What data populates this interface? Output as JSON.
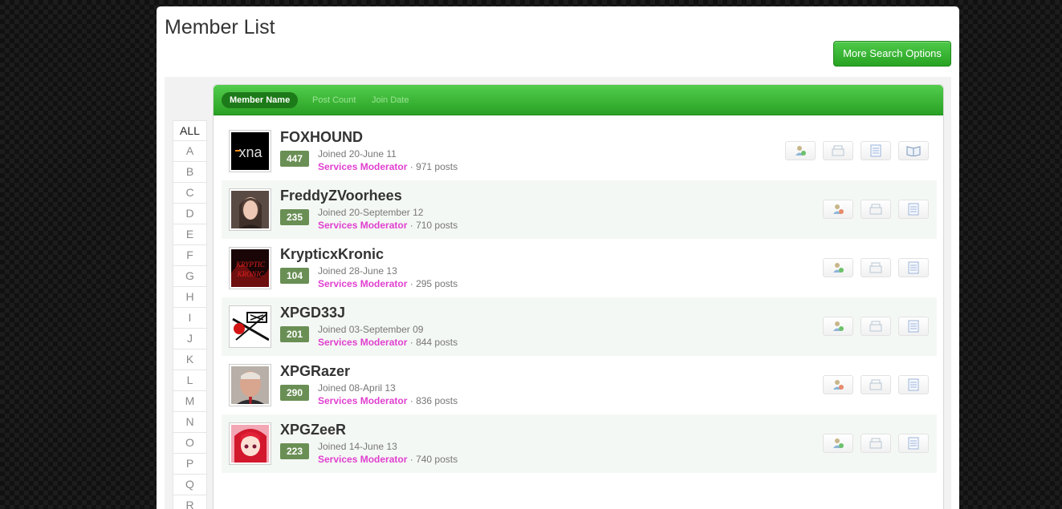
{
  "page": {
    "title": "Member List",
    "more_search_label": "More Search Options"
  },
  "sort_tabs": {
    "member_name": "Member Name",
    "post_count": "Post Count",
    "join_date": "Join Date"
  },
  "alphabet": [
    "ALL",
    "A",
    "B",
    "C",
    "D",
    "E",
    "F",
    "G",
    "H",
    "I",
    "J",
    "K",
    "L",
    "M",
    "N",
    "O",
    "P",
    "Q",
    "R"
  ],
  "colors": {
    "accent_green": "#2aa124",
    "role_pink": "#e040d0",
    "rep_badge": "#6a8f55"
  },
  "members": [
    {
      "name": "FOXHOUND",
      "rep": "447",
      "joined": "Joined 20-June 11",
      "role": "Services Moderator",
      "posts": "· 971 posts",
      "actions": [
        "add-friend-icon",
        "message-icon",
        "posts-icon",
        "blog-icon"
      ]
    },
    {
      "name": "FreddyZVoorhees",
      "rep": "235",
      "joined": "Joined 20-September 12",
      "role": "Services Moderator",
      "posts": "· 710 posts",
      "actions": [
        "add-friend-icon",
        "message-icon",
        "posts-icon"
      ]
    },
    {
      "name": "KrypticxKronic",
      "rep": "104",
      "joined": "Joined 28-June 13",
      "role": "Services Moderator",
      "posts": "· 295 posts",
      "actions": [
        "add-friend-icon",
        "message-icon",
        "posts-icon"
      ]
    },
    {
      "name": "XPGD33J",
      "rep": "201",
      "joined": "Joined 03-September 09",
      "role": "Services Moderator",
      "posts": "· 844 posts",
      "actions": [
        "add-friend-icon",
        "message-icon",
        "posts-icon"
      ]
    },
    {
      "name": "XPGRazer",
      "rep": "290",
      "joined": "Joined 08-April 13",
      "role": "Services Moderator",
      "posts": "· 836 posts",
      "actions": [
        "add-friend-icon",
        "message-icon",
        "posts-icon"
      ]
    },
    {
      "name": "XPGZeeR",
      "rep": "223",
      "joined": "Joined 14-June 13",
      "role": "Services Moderator",
      "posts": "· 740 posts",
      "actions": [
        "add-friend-icon",
        "message-icon",
        "posts-icon"
      ]
    }
  ]
}
